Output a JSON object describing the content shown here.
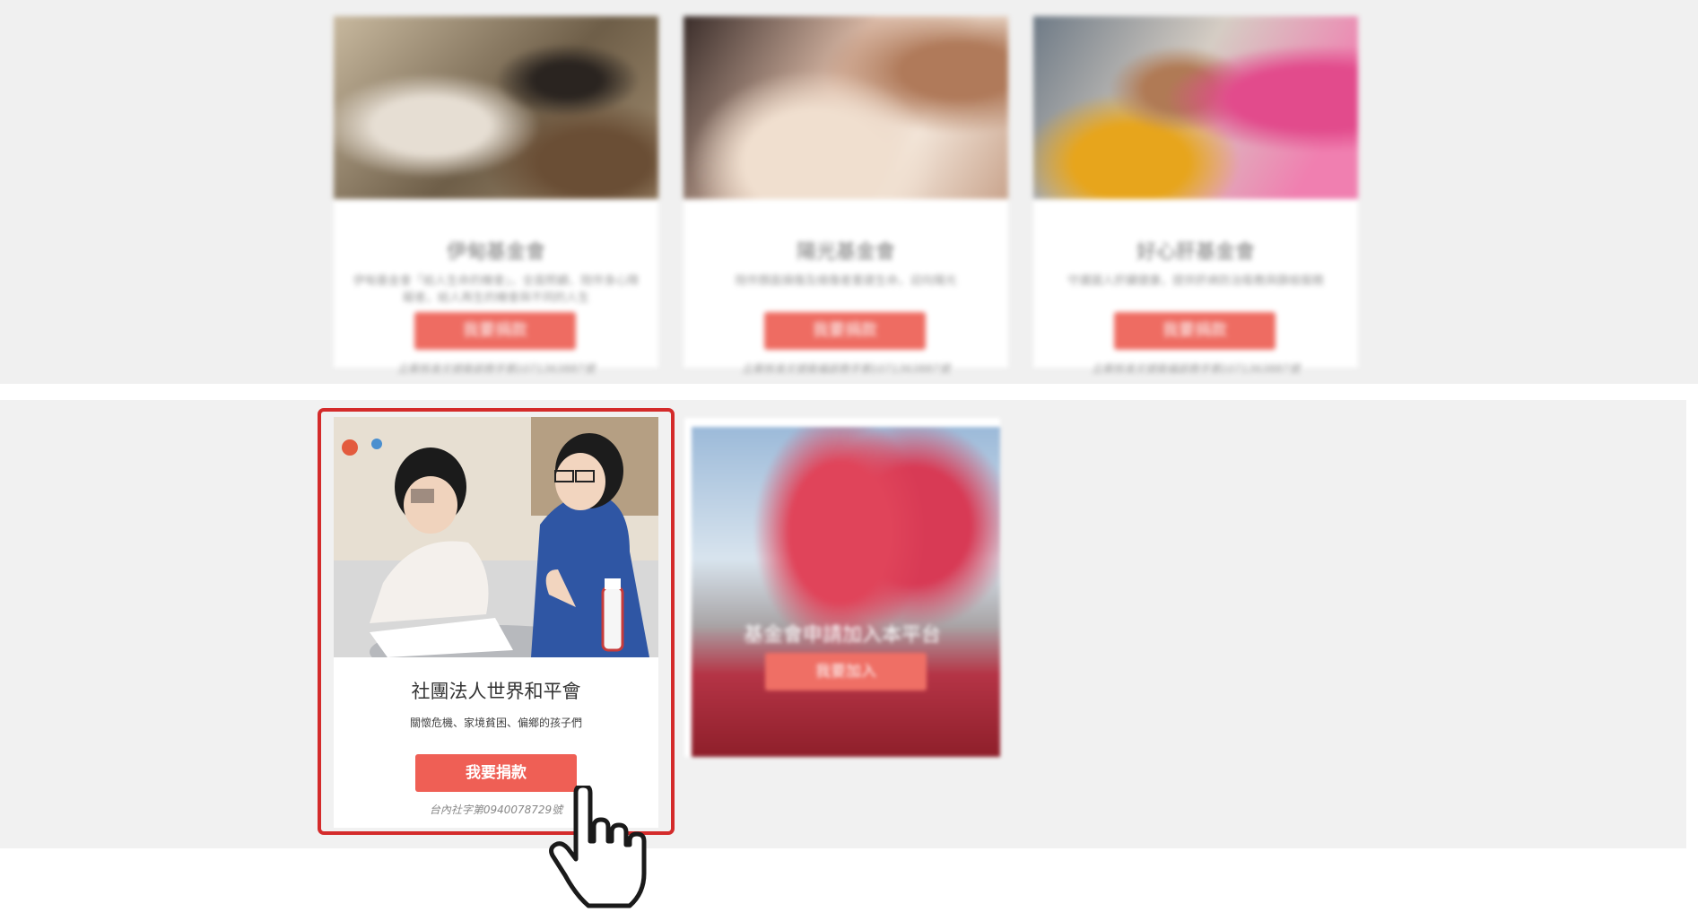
{
  "top_cards": [
    {
      "title": "伊甸基金會",
      "desc": "伊甸基金會「給人生命的機會」，全面照顧、陪伴身心障礙者，給人再生的機會與不同的人生",
      "button": "我要捐款",
      "note": "立案核准文號衛部救字第1071363887號"
    },
    {
      "title": "陽光基金會",
      "desc": "陪伴顏面損傷及燒傷者重建生命，迎向陽光",
      "button": "我要捐款",
      "note": "立案核准文號衛福部救字第1071363887號"
    },
    {
      "title": "好心肝基金會",
      "desc": "守護國人肝臟健康，提供肝病防治衛教與篩檢服務",
      "button": "我要捐款",
      "note": "立案核准文號衛福部救字第1071363887號"
    }
  ],
  "featured_card": {
    "title": "社團法人世界和平會",
    "desc": "關懷危機、家境貧困、偏鄉的孩子們",
    "button": "我要捐款",
    "note": "台內社字第0940078729號"
  },
  "join_card": {
    "title": "基金會申請加入本平台",
    "button": "我要加入"
  },
  "colors": {
    "accent": "#ef5f55",
    "highlight": "#d42b2b"
  },
  "icons": {
    "cursor": "hand-pointer-icon"
  }
}
